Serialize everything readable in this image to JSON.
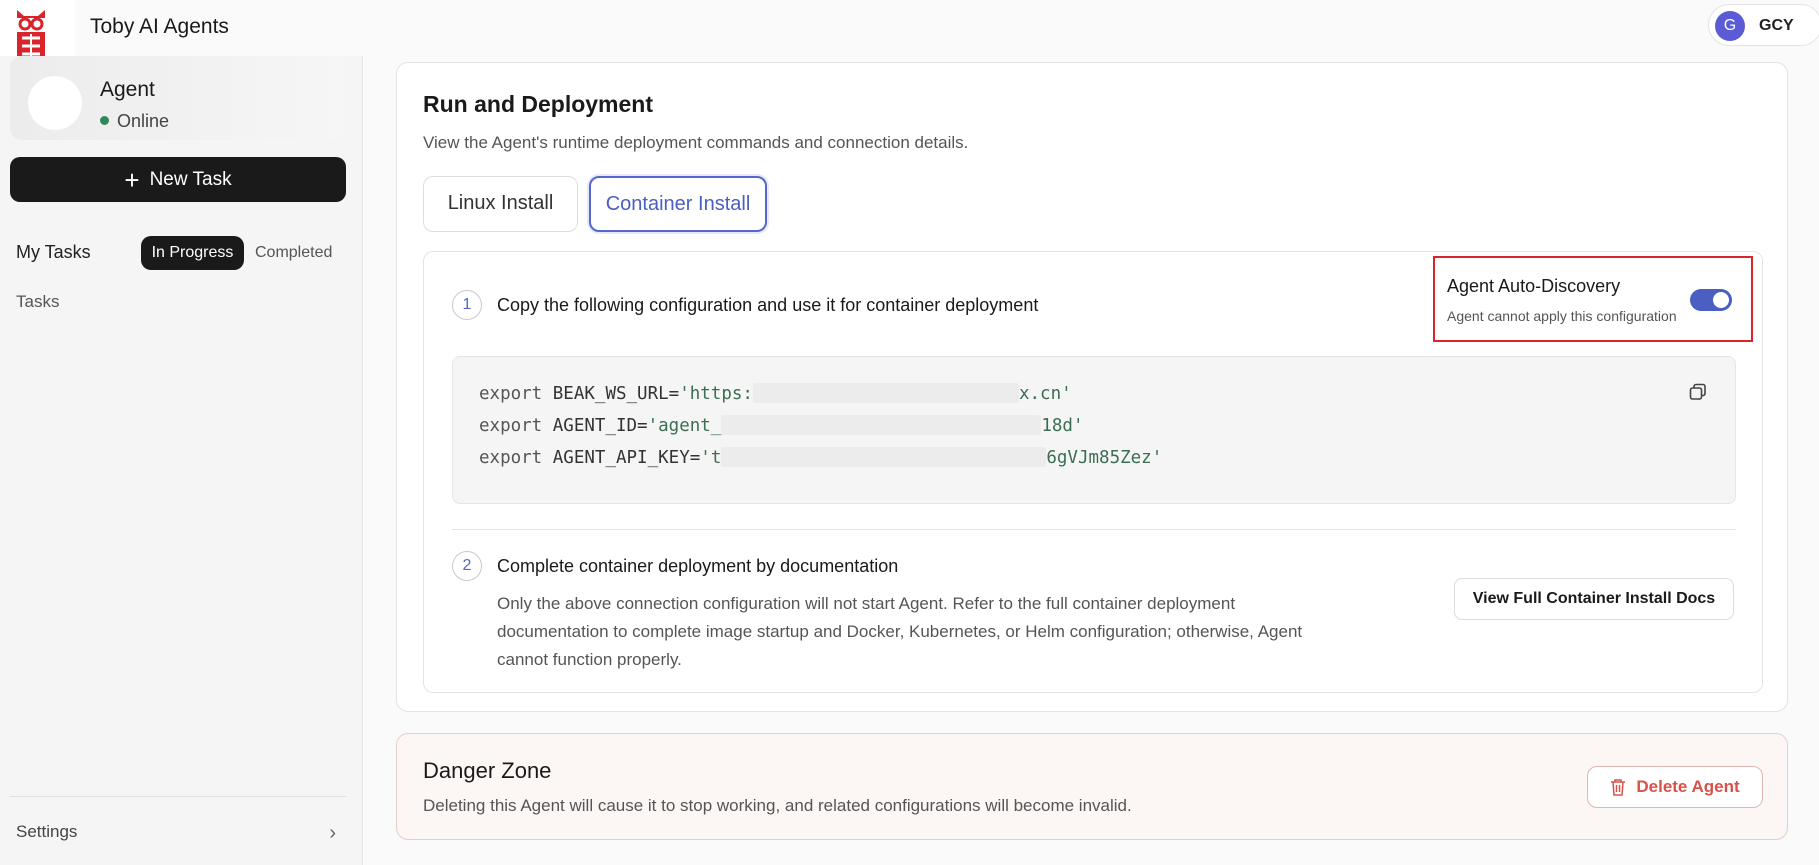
{
  "header": {
    "app_title": "Toby AI Agents",
    "user": {
      "initial": "G",
      "name": "GCY",
      "avatar_color": "#5b5bd6"
    }
  },
  "sidebar": {
    "agent": {
      "name": "Agent",
      "status": "Online",
      "status_color": "#2e8b57"
    },
    "new_task_label": "New Task",
    "my_tasks_label": "My Tasks",
    "filters": {
      "in_progress": "In Progress",
      "completed": "Completed",
      "selected": "In Progress"
    },
    "tasks_label": "Tasks",
    "settings_label": "Settings"
  },
  "main": {
    "title": "Run and Deployment",
    "description": "View the Agent's runtime deployment commands and connection details.",
    "tabs": [
      {
        "label": "Linux Install",
        "active": false
      },
      {
        "label": "Container Install",
        "active": true
      }
    ],
    "step1": {
      "number": "1",
      "text": "Copy the following configuration and use it for container deployment"
    },
    "auto_discovery": {
      "title": "Agent Auto-Discovery",
      "subtitle": "Agent cannot apply this configuration",
      "enabled": true
    },
    "code": {
      "line1": {
        "keyword": "export",
        "var": "BEAK_WS_URL=",
        "start": "'https:",
        "end": "x.cn'"
      },
      "line2": {
        "keyword": "export",
        "var": "AGENT_ID=",
        "start": "'agent_",
        "end": "18d'"
      },
      "line3": {
        "keyword": "export",
        "var": "AGENT_API_KEY=",
        "start": "'t",
        "end": "6gVJm85Zez'"
      }
    },
    "step2": {
      "number": "2",
      "title": "Complete container deployment by documentation",
      "description": "Only the above connection configuration will not start Agent. Refer to the full container deployment documentation to complete image startup and Docker, Kubernetes, or Helm configuration; otherwise, Agent cannot function properly.",
      "button_label": "View Full Container Install Docs"
    }
  },
  "danger": {
    "title": "Danger Zone",
    "description": "Deleting this Agent will cause it to stop working, and related configurations will become invalid.",
    "button_label": "Delete Agent",
    "accent_color": "#d9524a"
  }
}
